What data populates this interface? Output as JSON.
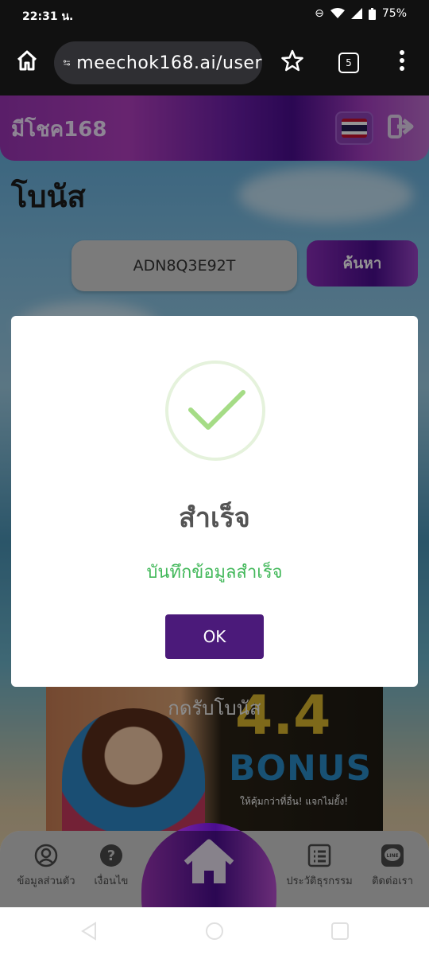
{
  "status_bar": {
    "time": "22:31 น.",
    "battery": "75%"
  },
  "browser": {
    "url": "meechok168.ai/user",
    "tab_count": "5"
  },
  "site": {
    "brand": "มีโชค168",
    "page_title": "โบนัส"
  },
  "search": {
    "value": "ADN8Q3E92T",
    "button_label": "ค้นหา"
  },
  "banner": {
    "text": "กดรับโบนัส",
    "big": "4.4",
    "bonus": "BONUS",
    "sub": "ให้คุ้มกว่าที่อื่น! แจกไม่ยั้ง!"
  },
  "dialog": {
    "title": "สำเร็จ",
    "message": "บันทึกข้อมูลสำเร็จ",
    "ok_label": "OK",
    "accent": "#42b85a",
    "button_color": "#4b1a7a"
  },
  "bottom_nav": {
    "items": [
      {
        "label": "ข้อมูลส่วนตัว",
        "icon": "user-circle-icon"
      },
      {
        "label": "เงื่อนไข",
        "icon": "help-circle-icon"
      },
      {
        "label": "",
        "icon": "home-icon"
      },
      {
        "label": "ประวัติธุรกรรม",
        "icon": "list-icon"
      },
      {
        "label": "ติดต่อเรา",
        "icon": "line-icon"
      }
    ]
  }
}
